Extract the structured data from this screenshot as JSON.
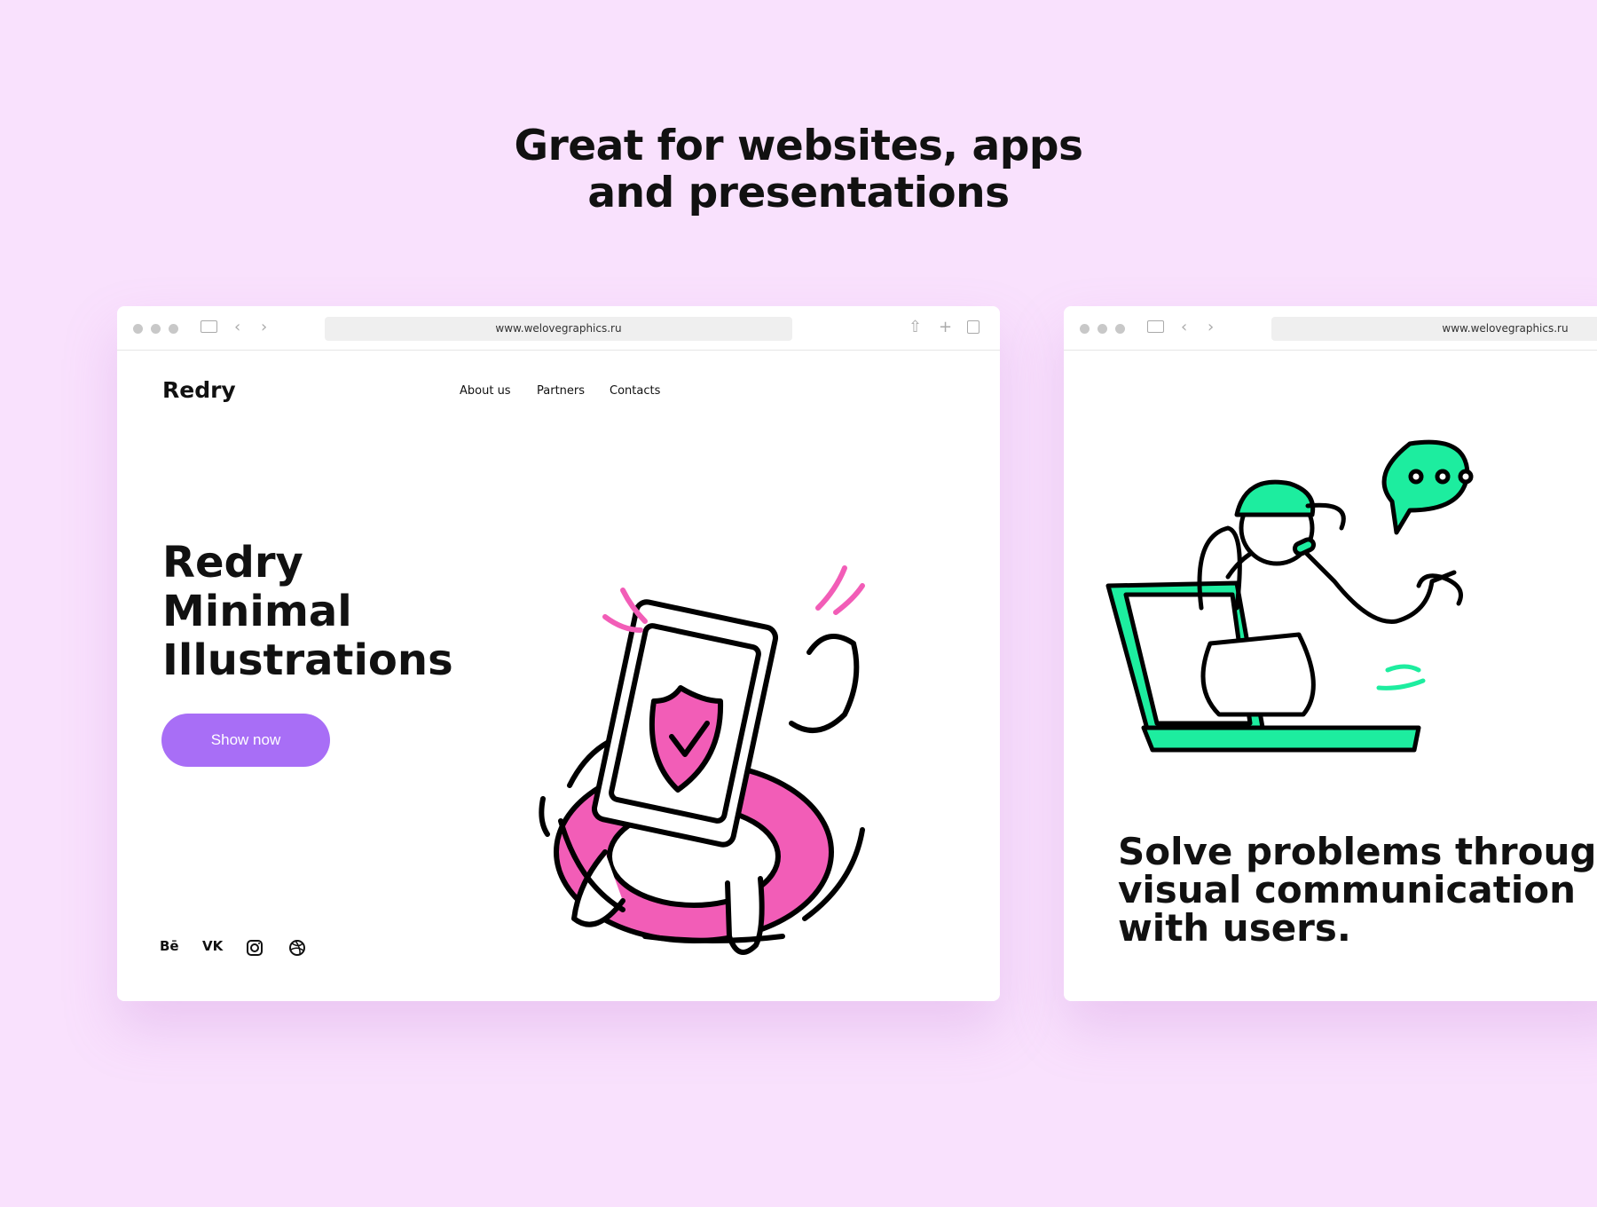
{
  "headline": {
    "line1": "Great for websites, apps",
    "line2": "and presentations"
  },
  "left_window": {
    "url": "www.welovegraphics.ru",
    "logo": "Redry",
    "nav": [
      "About us",
      "Partners",
      "Contacts"
    ],
    "hero": [
      "Redry",
      "Minimal",
      "Illustrations"
    ],
    "button": "Show now",
    "social": [
      {
        "label": "Bē",
        "icon": "behance-icon"
      },
      {
        "label": "VK",
        "icon": "vk-icon"
      },
      {
        "icon": "instagram-icon"
      },
      {
        "icon": "dribbble-icon"
      }
    ]
  },
  "right_window": {
    "url": "www.welovegraphics.ru",
    "heading": [
      "Solve problems through",
      "visual communication",
      "with users."
    ]
  },
  "colors": {
    "background": "#f9e1fd",
    "button": "#a86ef6",
    "pink": "#f25db7",
    "green": "#1ded9f"
  }
}
